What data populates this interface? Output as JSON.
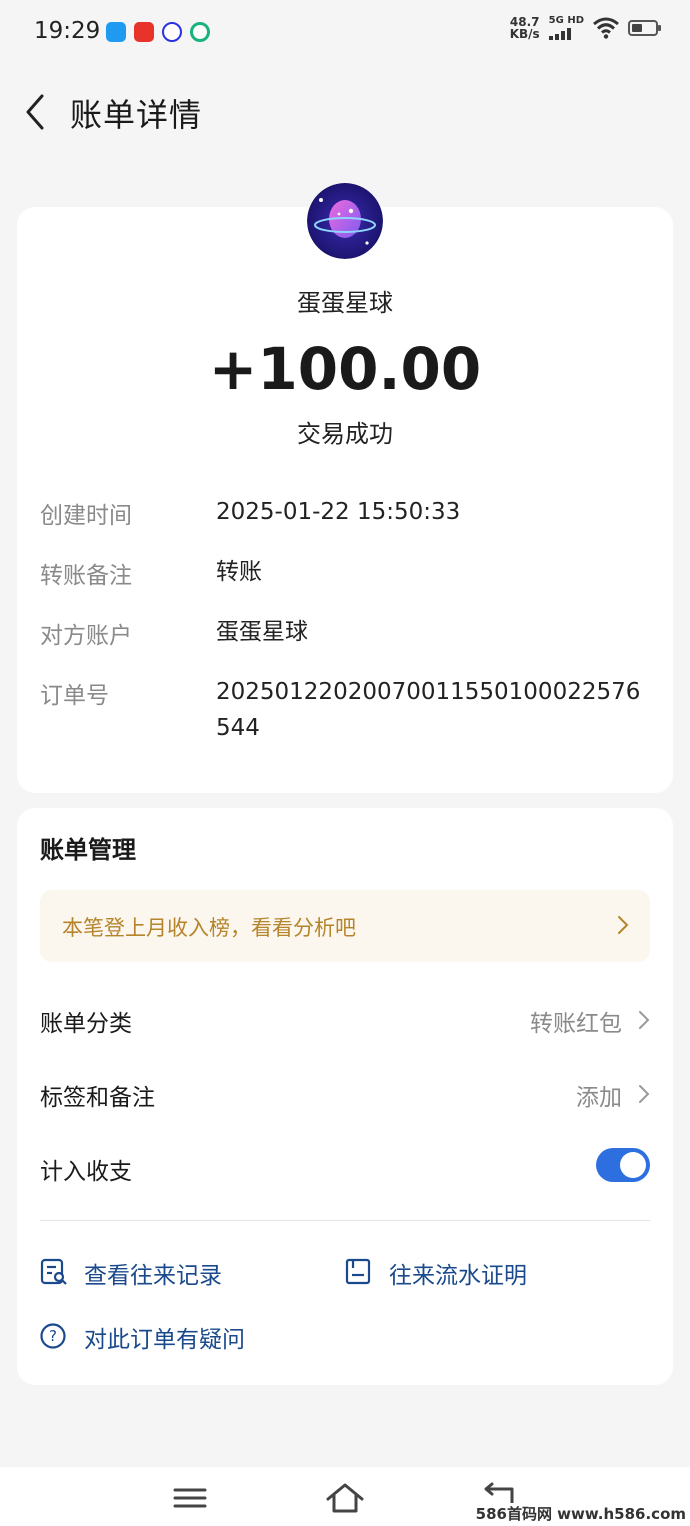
{
  "status_bar": {
    "time": "19:29",
    "net_speed_value": "48.7",
    "net_speed_unit": "KB/s",
    "network_type": "5G HD",
    "app_icons": [
      "app-icon-blue",
      "toutiao-icon",
      "baidu-icon",
      "green-app-icon"
    ]
  },
  "header": {
    "title": "账单详情"
  },
  "transaction": {
    "merchant": "蛋蛋星球",
    "amount": "+100.00",
    "status": "交易成功",
    "details": [
      {
        "label": "创建时间",
        "value": "2025-01-22 15:50:33"
      },
      {
        "label": "转账备注",
        "value": "转账"
      },
      {
        "label": "对方账户",
        "value": "蛋蛋星球"
      },
      {
        "label": "订单号",
        "value": "20250122020070011550100022576544"
      }
    ]
  },
  "management": {
    "title": "账单管理",
    "promo": "本笔登上月收入榜，看看分析吧",
    "category_label": "账单分类",
    "category_value": "转账红包",
    "tags_label": "标签和备注",
    "tags_value": "添加",
    "count_label": "计入收支",
    "count_enabled": true,
    "links": {
      "history": "查看往来记录",
      "proof": "往来流水证明",
      "question": "对此订单有疑问"
    }
  },
  "watermark": "586首码网 www.h586.com",
  "colors": {
    "accent": "#2e6fe0",
    "link": "#1b4a8c",
    "promo_text": "#b5842c",
    "promo_bg": "#fcf7ee"
  }
}
